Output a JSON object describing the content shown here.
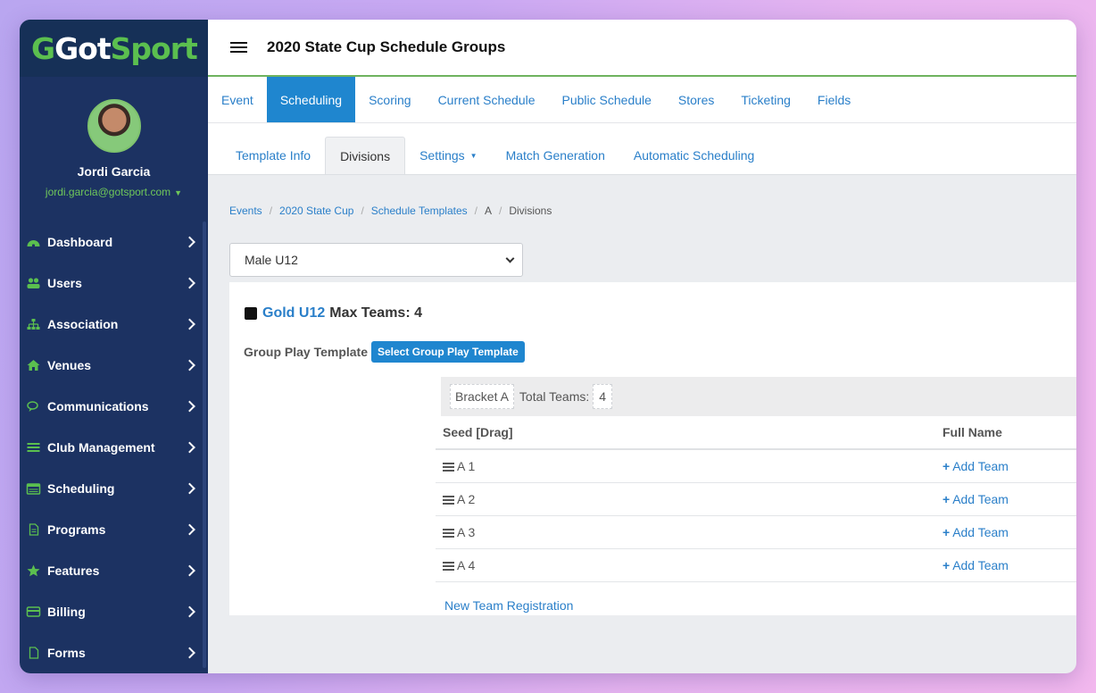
{
  "brand": {
    "logo_got": "Got",
    "logo_sport": "Sport",
    "logo_g": "G",
    "accent": "#5bbf4f",
    "sidebar_bg": "#1c3262"
  },
  "user": {
    "name": "Jordi Garcia",
    "email": "jordi.garcia@gotsport.com"
  },
  "sidebar": {
    "items": [
      {
        "label": "Dashboard",
        "icon": "dashboard-icon"
      },
      {
        "label": "Users",
        "icon": "users-icon"
      },
      {
        "label": "Association",
        "icon": "sitemap-icon"
      },
      {
        "label": "Venues",
        "icon": "home-icon"
      },
      {
        "label": "Communications",
        "icon": "comments-icon"
      },
      {
        "label": "Club Management",
        "icon": "list-icon"
      },
      {
        "label": "Scheduling",
        "icon": "calendar-icon"
      },
      {
        "label": "Programs",
        "icon": "file-icon"
      },
      {
        "label": "Features",
        "icon": "star-icon"
      },
      {
        "label": "Billing",
        "icon": "credit-card-icon"
      },
      {
        "label": "Forms",
        "icon": "document-icon"
      }
    ]
  },
  "header": {
    "title": "2020 State Cup Schedule Groups"
  },
  "main_tabs": [
    "Event",
    "Scheduling",
    "Scoring",
    "Current Schedule",
    "Public Schedule",
    "Stores",
    "Ticketing",
    "Fields"
  ],
  "sub_tabs": [
    "Template Info",
    "Divisions",
    "Settings",
    "Match Generation",
    "Automatic Scheduling"
  ],
  "breadcrumb": [
    "Events",
    "2020 State Cup",
    "Schedule Templates",
    "A",
    "Divisions"
  ],
  "division_select": {
    "value": "Male U12"
  },
  "division": {
    "name": "Gold U12",
    "max_teams": "Max Teams: 4",
    "group_play_label": "Group Play Template",
    "group_play_button": "Select Group Play Template"
  },
  "bracket": {
    "name": "Bracket A",
    "total_label": "Total Teams:",
    "total": "4",
    "columns": [
      "Seed [Drag]",
      "Full Name"
    ],
    "rows": [
      {
        "seed": "A 1",
        "action": "Add Team"
      },
      {
        "seed": "A 2",
        "action": "Add Team"
      },
      {
        "seed": "A 3",
        "action": "Add Team"
      },
      {
        "seed": "A 4",
        "action": "Add Team"
      }
    ],
    "new_registration": "New Team Registration"
  }
}
